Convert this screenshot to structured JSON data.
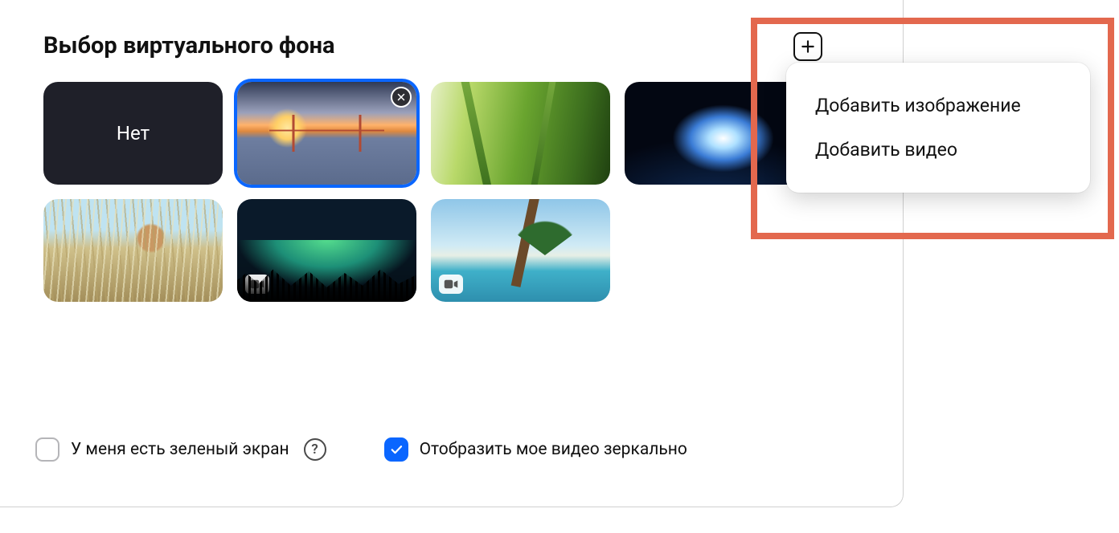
{
  "title": "Выбор виртуального фона",
  "none_label": "Нет",
  "add_menu": {
    "add_image": "Добавить изображение",
    "add_video": "Добавить видео"
  },
  "tiles": [
    {
      "kind": "none"
    },
    {
      "kind": "image",
      "name": "golden-gate-bridge",
      "selected": true,
      "removable": true
    },
    {
      "kind": "image",
      "name": "grass"
    },
    {
      "kind": "image",
      "name": "earth-from-space"
    },
    {
      "kind": "image",
      "name": "cougar-meadow"
    },
    {
      "kind": "video",
      "name": "aurora"
    },
    {
      "kind": "video",
      "name": "beach-palm"
    }
  ],
  "options": {
    "green_screen_label": "У меня есть зеленый экран",
    "green_screen_checked": false,
    "mirror_label": "Отобразить мое видео зеркально",
    "mirror_checked": true
  },
  "help_glyph": "?"
}
